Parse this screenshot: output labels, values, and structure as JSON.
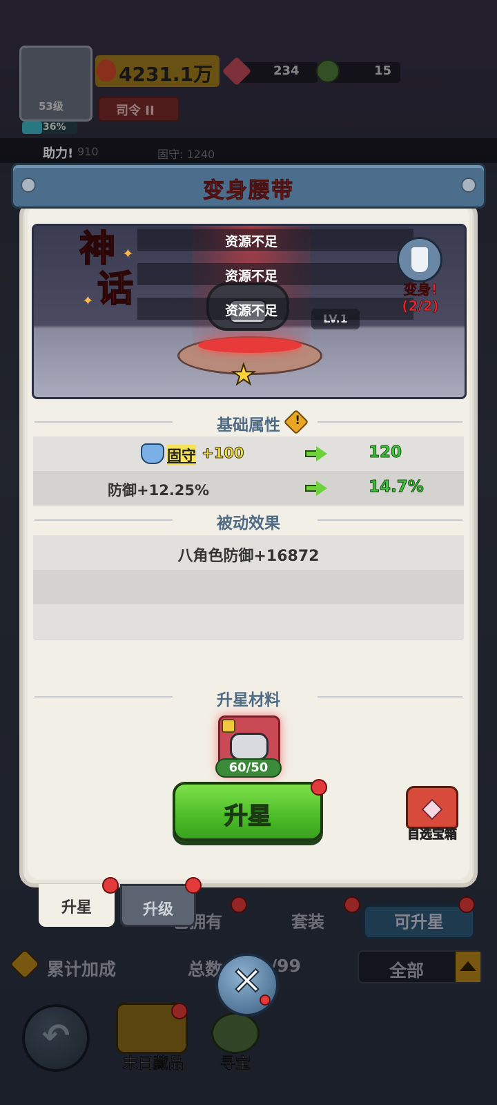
{
  "hud": {
    "level": "53级",
    "exp_percent": "36%",
    "exp_fraction": 0.36,
    "power": "4231.1万",
    "gems": "234",
    "orbs": "15",
    "rank": "司令 II",
    "help_label": "助力!",
    "help_value": "910",
    "help_stat": "固守: 1240"
  },
  "modal": {
    "title": "变身腰带",
    "rarity_char_1": "神",
    "rarity_char_2": "话",
    "notices": [
      "资源不足",
      "资源不足",
      "资源不足"
    ],
    "level_tag": "LV.1",
    "transform_label_line1": "变身!",
    "transform_label_line2": "(2/2)",
    "base_section_title": "基础属性",
    "base_attrs": [
      {
        "label_keyword": "固守",
        "label_suffix": "+100",
        "new_value": "120"
      },
      {
        "label": "防御+12.25%",
        "new_value": "14.7%"
      }
    ],
    "passive_section_title": "被动效果",
    "passive_effects": [
      "八角色防御+16872",
      "",
      ""
    ],
    "material_section_title": "升星材料",
    "material_count": "60/50",
    "upgrade_button": "升星",
    "chest_label": "自选宝箱"
  },
  "tabs": {
    "star_tab": "升星",
    "level_tab": "升级"
  },
  "background_ui": {
    "filter_owned": "已拥有",
    "filter_set": "套装",
    "filter_upgradable": "可升星",
    "bonus_label": "累计加成",
    "total_label": "总数",
    "total_value": "/99",
    "dropdown_value": "全部",
    "nav_collection": "末日藏品",
    "nav_treasure": "寻宝"
  },
  "colors": {
    "title_red": "#e03a3a",
    "section_blue": "#4e6a84",
    "value_green": "#38c83a",
    "button_green": "#4cbc28"
  }
}
